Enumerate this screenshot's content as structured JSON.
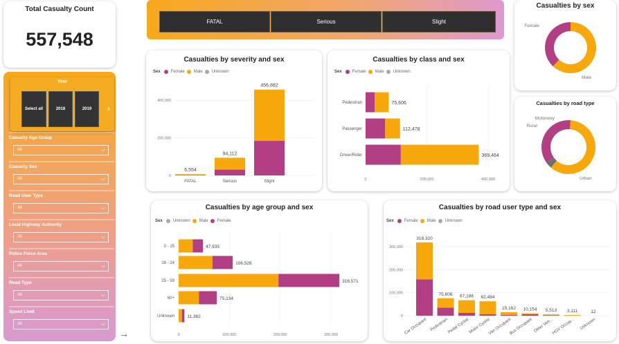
{
  "kpi": {
    "title": "Total Casualty Count",
    "value": "557,548"
  },
  "severity_buttons": [
    "FATAL",
    "Serious",
    "Slight"
  ],
  "slicers": {
    "year": {
      "title": "Year",
      "options": [
        "Select all",
        "2018",
        "2019"
      ]
    },
    "filters": [
      {
        "label": "Casualty Age Group",
        "value": "All"
      },
      {
        "label": "Casualty Sex",
        "value": "All"
      },
      {
        "label": "Road User Type",
        "value": "All"
      },
      {
        "label": "Local Highway Authority",
        "value": "All"
      },
      {
        "label": "Police Force Area",
        "value": "All"
      },
      {
        "label": "Road Type",
        "value": "All"
      },
      {
        "label": "Speed Limit",
        "value": "All"
      }
    ]
  },
  "colors": {
    "female": "#b23f84",
    "male": "#f7a80d",
    "unknown": "#a8a8a8",
    "motorway": "#6f6f6f"
  },
  "legend": {
    "sex_label": "Sex",
    "female": "Female",
    "male": "Male",
    "unknown": "Unknown"
  },
  "chart_data": [
    {
      "id": "severity_sex",
      "type": "bar",
      "title": "Casualties by severity and sex",
      "categories": [
        "FATAL",
        "Serious",
        "Slight"
      ],
      "series": [
        {
          "name": "Female",
          "values": [
            1600,
            31000,
            185000
          ]
        },
        {
          "name": "Male",
          "values": [
            4954,
            63112,
            271882
          ]
        }
      ],
      "totals": [
        "6,554",
        "94,112",
        "456,882"
      ],
      "yticks": [
        "0",
        "200,000",
        "400,000"
      ],
      "ylim": [
        0,
        500000
      ]
    },
    {
      "id": "class_sex",
      "type": "bar",
      "orientation": "horizontal",
      "title": "Casualties by class and sex",
      "categories": [
        "Pedestrian",
        "Passenger",
        "Driver/Rider"
      ],
      "series": [
        {
          "name": "Female",
          "values": [
            30000,
            64000,
            115000
          ]
        },
        {
          "name": "Male",
          "values": [
            45606,
            48478,
            254464
          ]
        }
      ],
      "totals": [
        "75,606",
        "112,478",
        "369,464"
      ],
      "xticks": [
        "0",
        "200,000",
        "400,000"
      ],
      "xlim": [
        0,
        420000
      ]
    },
    {
      "id": "sex_donut",
      "type": "pie",
      "title": "Casualties by sex",
      "labels": [
        "Female",
        "Male"
      ],
      "values": [
        38,
        62
      ]
    },
    {
      "id": "road_type_donut",
      "type": "pie",
      "title": "Casualties by road type",
      "labels": [
        "Motorway",
        "Rural",
        "Urban"
      ],
      "values": [
        4,
        36,
        60
      ]
    },
    {
      "id": "age_sex",
      "type": "bar",
      "orientation": "horizontal",
      "title": "Casualties by age group and sex",
      "categories": [
        "0 - 15",
        "16 - 24",
        "25 - 59",
        "60+",
        "Unknown"
      ],
      "series": [
        {
          "name": "Male",
          "values": [
            27935,
            66526,
            196571
          ],
          "note": ""
        },
        {
          "name": "Female",
          "values": [
            20000,
            40000,
            120000
          ]
        }
      ],
      "male_values": [
        27935,
        66526,
        196571,
        40134,
        6382
      ],
      "female_values": [
        20000,
        40000,
        120000,
        35000,
        5000
      ],
      "totals": [
        "47,935",
        "106,526",
        "316,571",
        "75,134",
        "11,382"
      ],
      "xticks": [
        "0",
        "100,000",
        "200,000",
        "300,000"
      ],
      "xlim": [
        0,
        340000
      ]
    },
    {
      "id": "road_user_sex",
      "type": "bar",
      "title": "Casualties by road user type and sex",
      "categories": [
        "Car Occupant",
        "Pedestrian",
        "Pedal Cyclist",
        "Motor Cyclist",
        "Van Occupant",
        "Bus Occupant",
        "Other Veh...",
        "HGV Occup...",
        "Unknown"
      ],
      "female_values": [
        158000,
        35000,
        12000,
        6000,
        3500,
        6200,
        1500,
        400,
        4
      ],
      "male_values": [
        160320,
        40606,
        55186,
        56484,
        11662,
        3954,
        4013,
        2711,
        8
      ],
      "totals": [
        "318,320",
        "75,606",
        "67,186",
        "62,484",
        "15,162",
        "10,154",
        "5,513",
        "3,111",
        "12"
      ],
      "yticks": [
        "0",
        "100,000",
        "200,000",
        "300,000"
      ],
      "ylim": [
        0,
        340000
      ]
    }
  ]
}
